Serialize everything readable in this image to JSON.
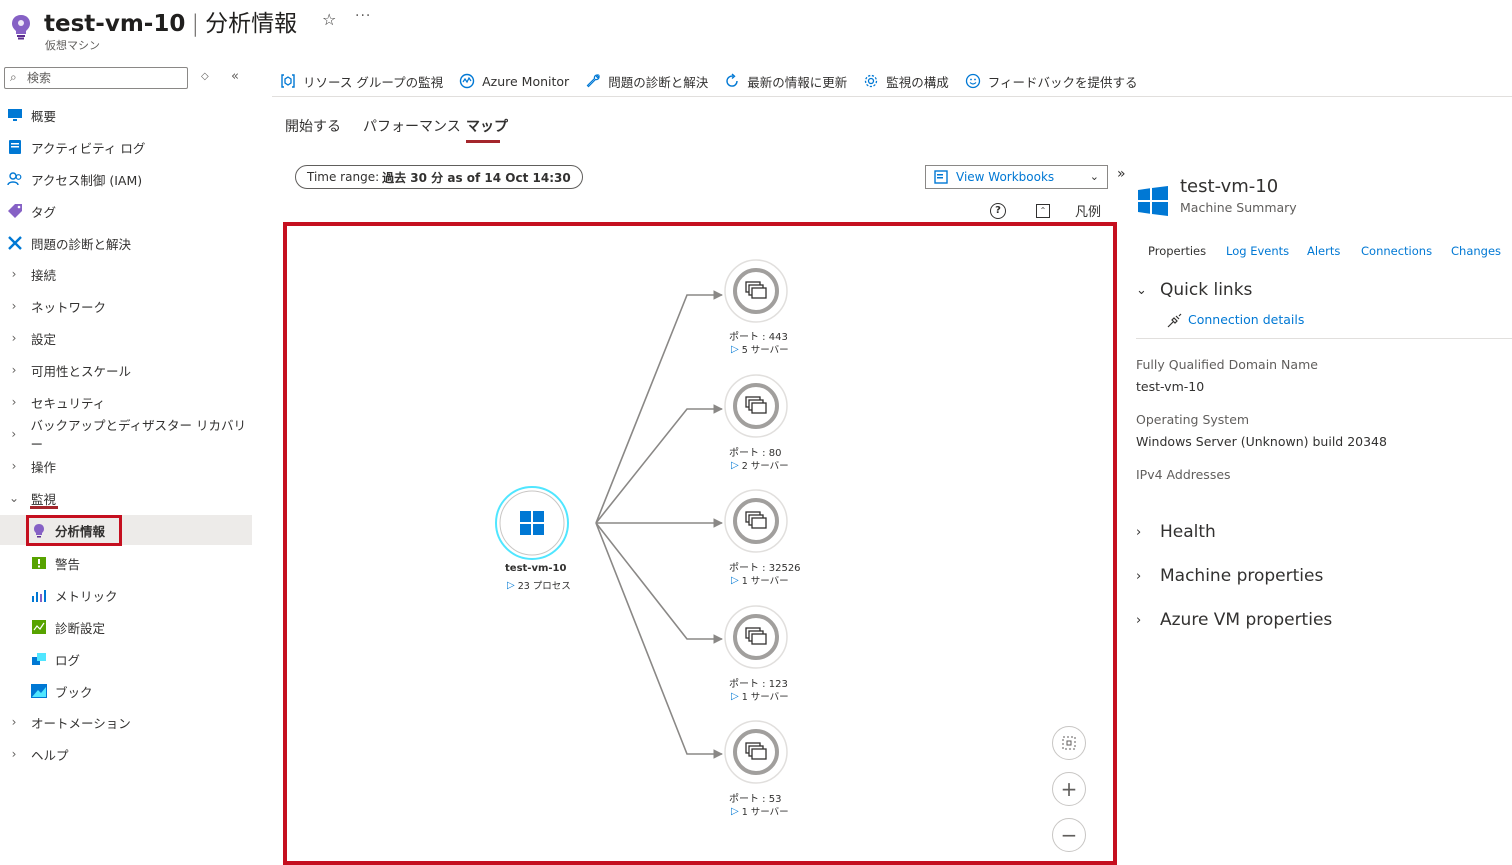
{
  "header": {
    "vm_name": "test-vm-10",
    "separator": "|",
    "page_title": "分析情報",
    "subtitle": "仮想マシン"
  },
  "search": {
    "placeholder": "検索"
  },
  "sidebar": {
    "items": [
      {
        "label": "概要",
        "icon": "monitor-icon"
      },
      {
        "label": "アクティビティ ログ",
        "icon": "activity-log-icon"
      },
      {
        "label": "アクセス制御 (IAM)",
        "icon": "people-icon"
      },
      {
        "label": "タグ",
        "icon": "tag-icon"
      },
      {
        "label": "問題の診断と解決",
        "icon": "wrench-icon"
      },
      {
        "label": "接続",
        "icon": "chevron-right-icon"
      },
      {
        "label": "ネットワーク",
        "icon": "chevron-right-icon"
      },
      {
        "label": "設定",
        "icon": "chevron-right-icon"
      },
      {
        "label": "可用性とスケール",
        "icon": "chevron-right-icon"
      },
      {
        "label": "セキュリティ",
        "icon": "chevron-right-icon"
      },
      {
        "label": "バックアップとディザスター リカバリー",
        "icon": "chevron-right-icon"
      },
      {
        "label": "操作",
        "icon": "chevron-right-icon"
      },
      {
        "label": "監視",
        "icon": "chevron-down-icon"
      },
      {
        "label": "分析情報",
        "icon": "insights-bulb-icon"
      },
      {
        "label": "警告",
        "icon": "alert-icon"
      },
      {
        "label": "メトリック",
        "icon": "metrics-icon"
      },
      {
        "label": "診断設定",
        "icon": "diagnostic-settings-icon"
      },
      {
        "label": "ログ",
        "icon": "logs-icon"
      },
      {
        "label": "ブック",
        "icon": "workbook-icon"
      },
      {
        "label": "オートメーション",
        "icon": "chevron-right-icon"
      },
      {
        "label": "ヘルプ",
        "icon": "chevron-right-icon"
      }
    ]
  },
  "toolbar": {
    "items": [
      {
        "label": "リソース グループの監視",
        "icon": "resource-group-icon"
      },
      {
        "label": "Azure Monitor",
        "icon": "azure-monitor-icon"
      },
      {
        "label": "問題の診断と解決",
        "icon": "wrench-icon"
      },
      {
        "label": "最新の情報に更新",
        "icon": "refresh-icon"
      },
      {
        "label": "監視の構成",
        "icon": "gear-icon"
      },
      {
        "label": "フィードバックを提供する",
        "icon": "smiley-icon"
      }
    ]
  },
  "tabs": [
    {
      "label": "開始する"
    },
    {
      "label": "パフォーマンス"
    },
    {
      "label": "マップ",
      "active": true
    }
  ],
  "map_controls": {
    "time_range_label": "Time range:",
    "time_range_value": "過去 30 分 as of 14 Oct 14:30",
    "view_workbooks": "View Workbooks",
    "legend": "凡例"
  },
  "map": {
    "center": {
      "name": "test-vm-10",
      "detail": "23 プロセス"
    },
    "ports": [
      {
        "label": "ポート : 443",
        "detail": "5 サーバー"
      },
      {
        "label": "ポート : 80",
        "detail": "2 サーバー"
      },
      {
        "label": "ポート : 32526",
        "detail": "1 サーバー"
      },
      {
        "label": "ポート : 123",
        "detail": "1 サーバー"
      },
      {
        "label": "ポート : 53",
        "detail": "1 サーバー"
      }
    ]
  },
  "panel": {
    "title": "test-vm-10",
    "subtitle": "Machine Summary",
    "tabs": [
      "Properties",
      "Log Events",
      "Alerts",
      "Connections",
      "Changes"
    ],
    "quick_links_title": "Quick links",
    "connection_details": "Connection details",
    "fqdn_label": "Fully Qualified Domain Name",
    "fqdn_value": "test-vm-10",
    "os_label": "Operating System",
    "os_value": "Windows Server (Unknown) build 20348",
    "ipv4_label": "IPv4 Addresses",
    "sections": [
      "Health",
      "Machine properties",
      "Azure VM properties"
    ]
  },
  "colors": {
    "accent": "#0078d4",
    "highlight_red": "#c50f1f",
    "connector": "#8a8886",
    "center_ring": "#50e6ff"
  }
}
